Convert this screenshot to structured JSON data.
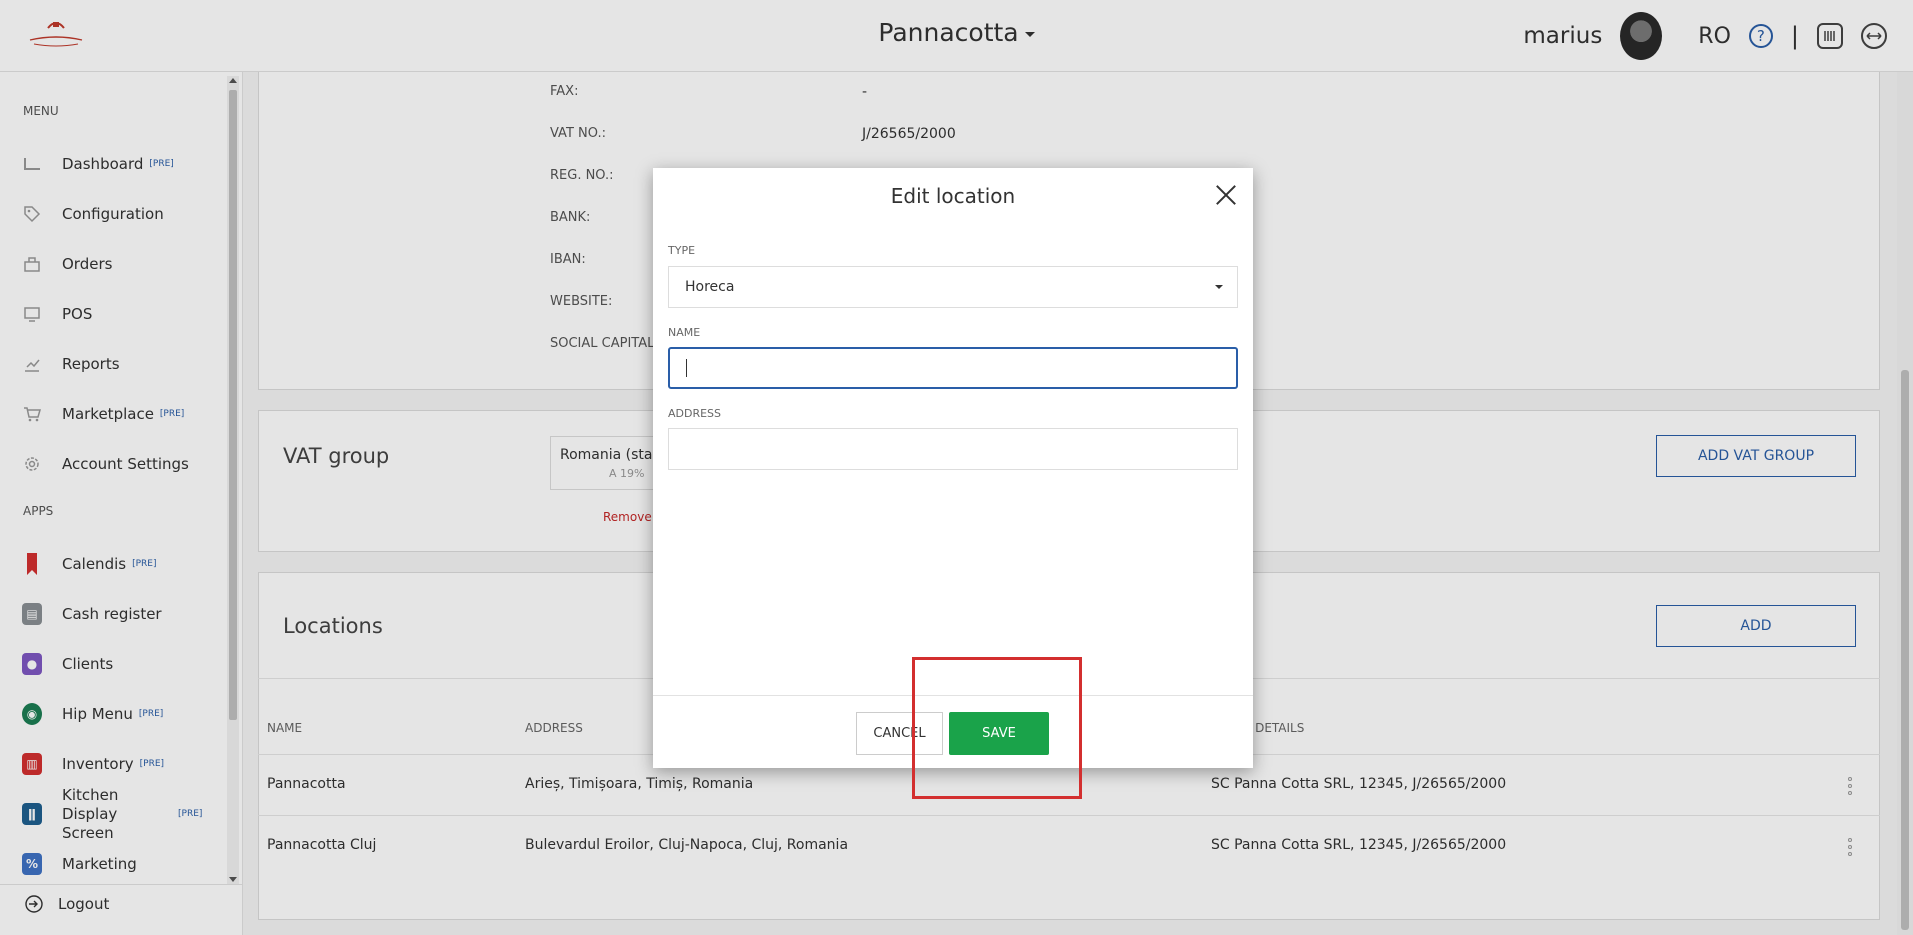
{
  "header": {
    "brand": "Pannacotta",
    "username": "marius",
    "language": "RO",
    "help_icon": "?",
    "separator": "|"
  },
  "sidebar": {
    "menu_heading": "MENU",
    "apps_heading": "APPS",
    "pre_badge": "[PRE]",
    "menu_items": [
      {
        "label": "Dashboard",
        "icon": "dashboard-icon",
        "pre": true
      },
      {
        "label": "Configuration",
        "icon": "tag-icon",
        "pre": false
      },
      {
        "label": "Orders",
        "icon": "orders-icon",
        "pre": false
      },
      {
        "label": "POS",
        "icon": "pos-icon",
        "pre": false
      },
      {
        "label": "Reports",
        "icon": "reports-icon",
        "pre": false
      },
      {
        "label": "Marketplace",
        "icon": "cart-icon",
        "pre": true
      },
      {
        "label": "Account Settings",
        "icon": "gear-icon",
        "pre": false
      }
    ],
    "app_items": [
      {
        "label": "Calendis",
        "icon": "bookmark-icon",
        "pre": true,
        "color": "#d32f2f"
      },
      {
        "label": "Cash register",
        "icon": "cash-register-icon",
        "pre": false,
        "color": "#8a8f94"
      },
      {
        "label": "Clients",
        "icon": "clients-icon",
        "pre": false,
        "color": "#7e57c2"
      },
      {
        "label": "Hip Menu",
        "icon": "hip-menu-icon",
        "pre": true,
        "color": "#1b7d53"
      },
      {
        "label": "Inventory",
        "icon": "inventory-icon",
        "pre": true,
        "color": "#d32f2f"
      },
      {
        "label": "Kitchen Display Screen",
        "icon": "kitchen-icon",
        "pre": true,
        "color": "#1f5f8f"
      },
      {
        "label": "Marketing",
        "icon": "marketing-icon",
        "pre": false,
        "color": "#3f72c4"
      }
    ],
    "logout": "Logout"
  },
  "company_info": {
    "fax_label": "FAX:",
    "fax_value": "-",
    "vat_label": "VAT NO.:",
    "vat_value": "J/26565/2000",
    "reg_label": "REG. NO.:",
    "bank_label": "BANK:",
    "iban_label": "IBAN:",
    "website_label": "WEBSITE:",
    "social_capital_label": "SOCIAL CAPITAL"
  },
  "vat_group": {
    "title": "VAT group",
    "chip_text": "Romania (stan",
    "chip_sub": "A 19%",
    "remove": "Remove",
    "add_button": "ADD VAT GROUP"
  },
  "locations": {
    "title": "Locations",
    "add_button": "ADD",
    "headers": {
      "name": "NAME",
      "address": "ADDRESS",
      "billing": "NG DETAILS"
    },
    "rows": [
      {
        "name": "Pannacotta",
        "address": "Arieș, Timișoara, Timiș, Romania",
        "billing": "SC Panna Cotta SRL, 12345, J/26565/2000"
      },
      {
        "name": "Pannacotta Cluj",
        "address": "Bulevardul Eroilor, Cluj-Napoca, Cluj, Romania",
        "billing": "SC Panna Cotta SRL, 12345, J/26565/2000"
      }
    ]
  },
  "modal": {
    "title": "Edit location",
    "type_label": "TYPE",
    "type_value": "Horeca",
    "name_label": "NAME",
    "name_value": "",
    "address_label": "ADDRESS",
    "address_value": "",
    "cancel": "CANCEL",
    "save": "SAVE"
  },
  "colors": {
    "accent": "#2a5ea8",
    "save": "#1aa34a",
    "highlight": "#d32f2f"
  }
}
